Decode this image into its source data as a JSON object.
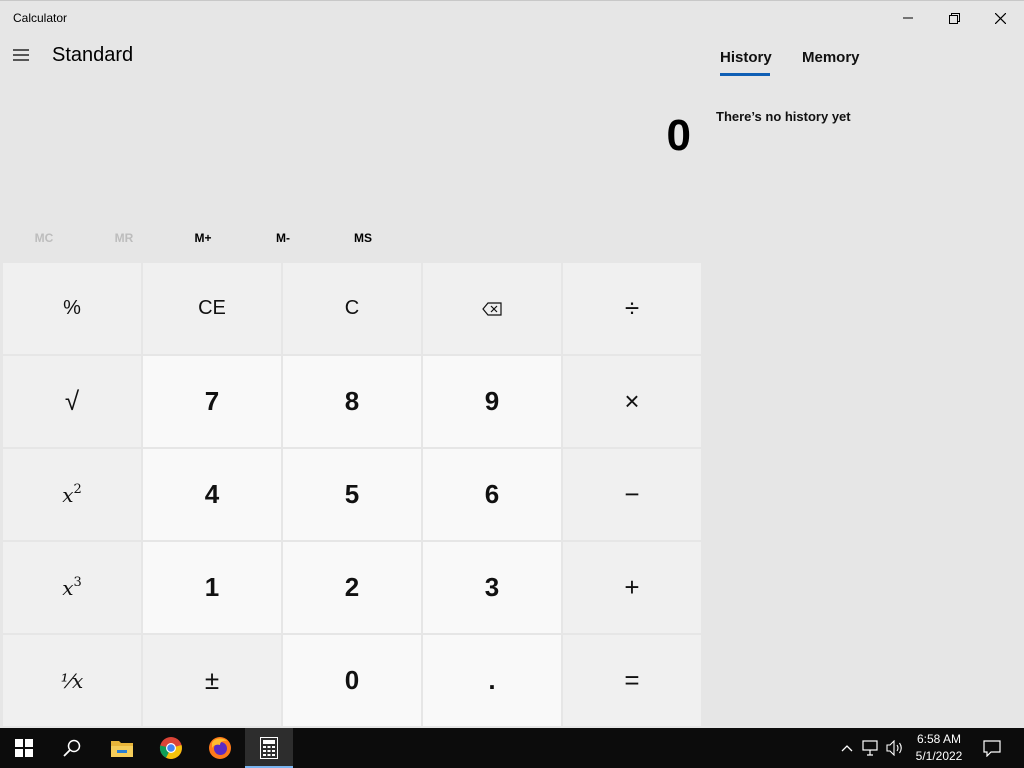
{
  "window": {
    "title": "Calculator",
    "controls": [
      "minimize-icon",
      "restore-icon",
      "close-icon"
    ]
  },
  "header": {
    "mode": "Standard",
    "menu_icon": "hamburger-icon"
  },
  "display": {
    "value": "0"
  },
  "memory": {
    "buttons": [
      {
        "label": "MC",
        "enabled": false
      },
      {
        "label": "MR",
        "enabled": false
      },
      {
        "label": "M+",
        "enabled": true
      },
      {
        "label": "M-",
        "enabled": true
      },
      {
        "label": "MS",
        "enabled": true
      }
    ]
  },
  "keys": {
    "percent": "%",
    "ce": "CE",
    "c": "C",
    "backspace_icon": "backspace-icon",
    "divide": "÷",
    "sqrt": "√",
    "seven": "7",
    "eight": "8",
    "nine": "9",
    "multiply": "×",
    "square_base": "x",
    "square_exp": "2",
    "four": "4",
    "five": "5",
    "six": "6",
    "minus": "−",
    "cube_base": "x",
    "cube_exp": "3",
    "one": "1",
    "two": "2",
    "three": "3",
    "plus": "+",
    "reciprocal": "⅟x",
    "negate": "±",
    "zero": "0",
    "decimal": ".",
    "equals": "="
  },
  "side_panel": {
    "tabs": [
      {
        "label": "History",
        "active": true
      },
      {
        "label": "Memory",
        "active": false
      }
    ],
    "empty_message": "There’s no history yet",
    "accent": "#0f5fb5"
  },
  "taskbar": {
    "apps": [
      "windows-start-icon",
      "search-icon",
      "file-explorer-icon",
      "chrome-icon",
      "firefox-icon",
      "calculator-icon"
    ],
    "time": "6:58 AM",
    "date": "5/1/2022",
    "tray_icons": [
      "chevron-up-icon",
      "network-icon",
      "volume-icon",
      "notification-icon"
    ]
  }
}
